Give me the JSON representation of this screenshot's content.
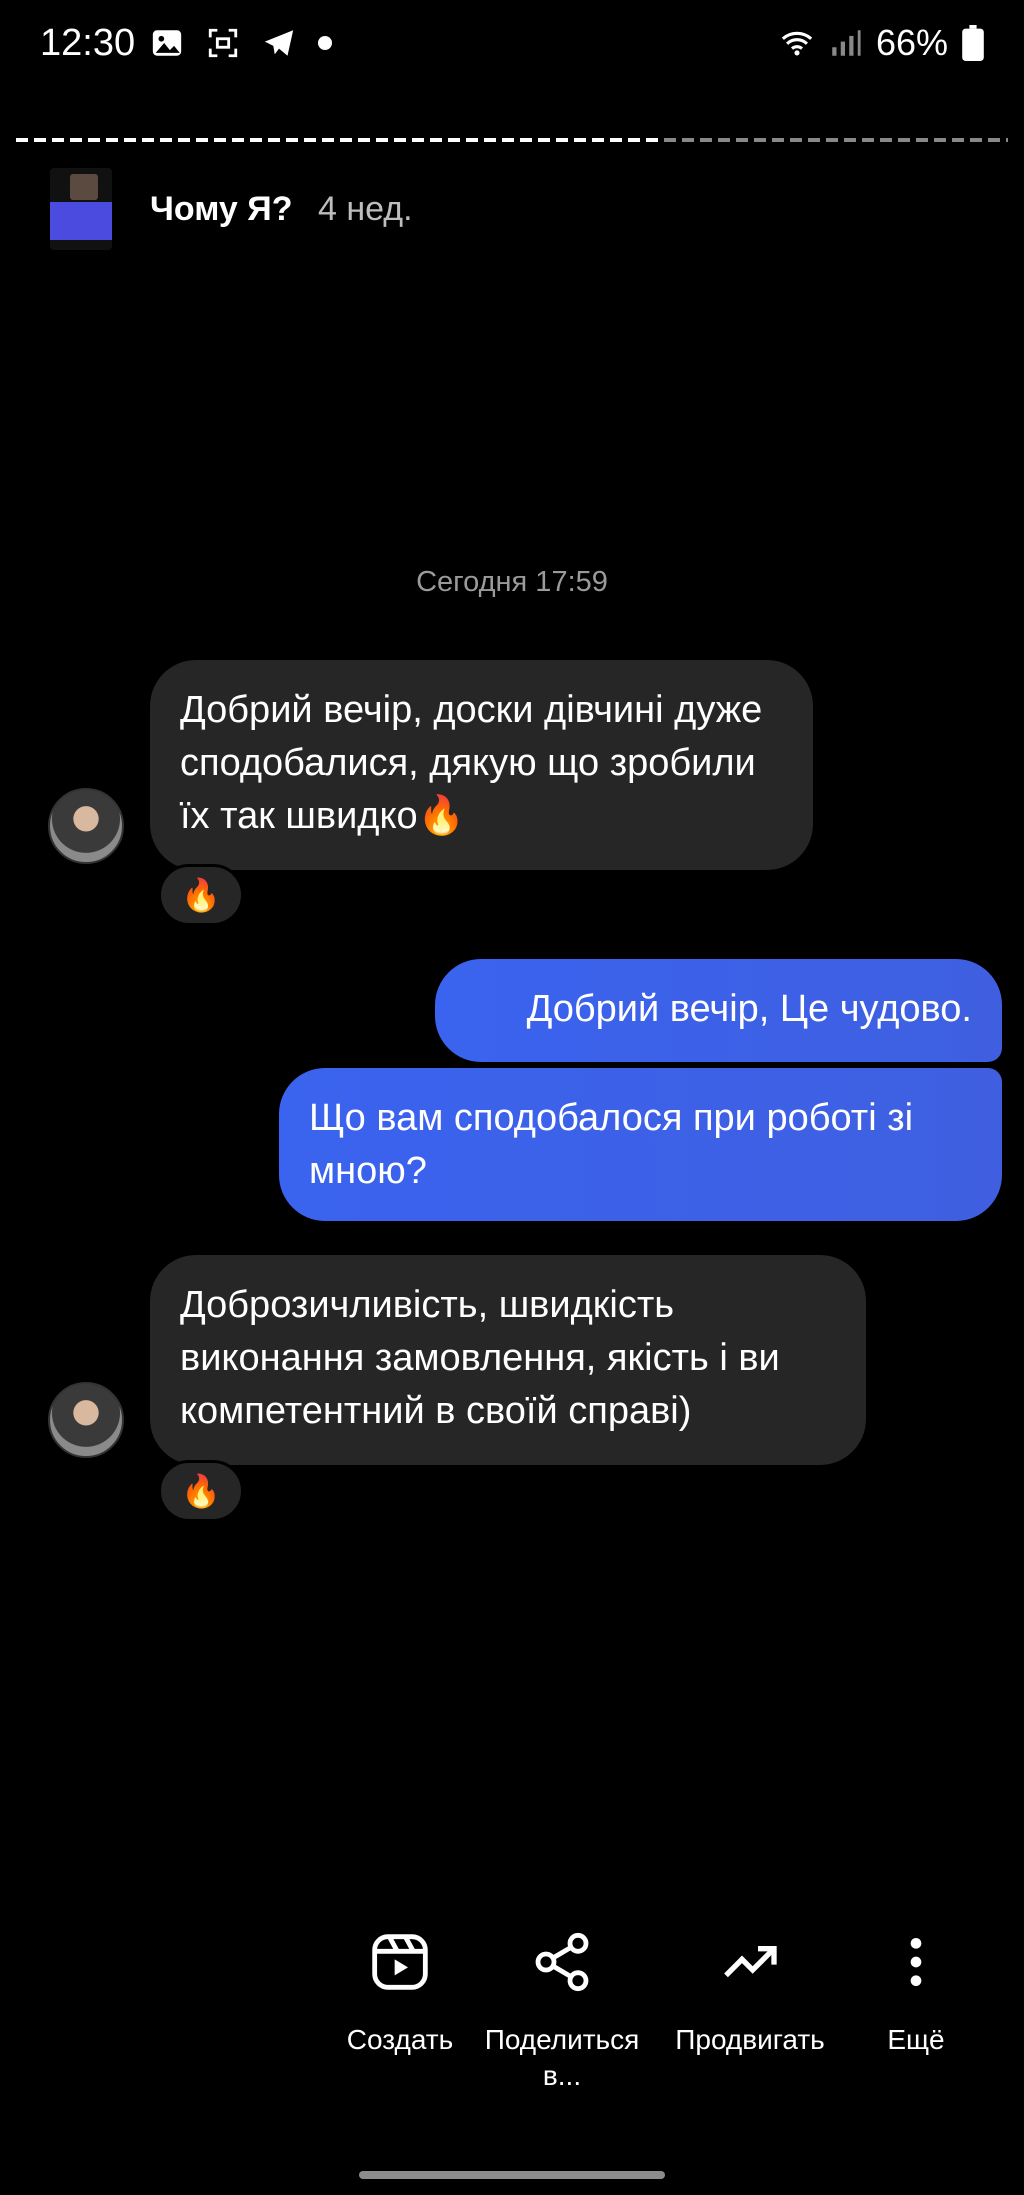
{
  "status_bar": {
    "time": "12:30",
    "battery": "66%",
    "icons": [
      "gallery-icon",
      "screenshot-icon",
      "telegram-icon",
      "dot-icon",
      "wifi-icon",
      "signal-icon",
      "battery-icon"
    ]
  },
  "story": {
    "title": "Чому Я?",
    "age": "4 нед."
  },
  "chat": {
    "timestamp": "Сегодня 17:59",
    "messages": [
      {
        "side": "incoming",
        "text": "Добрий вечір, доски дівчині дуже сподобалися, дякую що зробили їх так швидко🔥",
        "reaction": "🔥"
      },
      {
        "side": "outgoing",
        "text": "Добрий вечір, Це чудово."
      },
      {
        "side": "outgoing",
        "text": "Що вам сподобалося при роботі зі мною?"
      },
      {
        "side": "incoming",
        "text": "Доброзичливість, швидкість виконання замовлення, якість і ви компетентний в своїй справі)",
        "reaction": "🔥"
      }
    ]
  },
  "actions": {
    "create": "Создать",
    "share": "Поделиться в...",
    "promote": "Продвигать",
    "more": "Ещё"
  },
  "colors": {
    "background": "#000000",
    "incoming_bubble": "#262626",
    "outgoing_bubble": "#3b62ee"
  }
}
